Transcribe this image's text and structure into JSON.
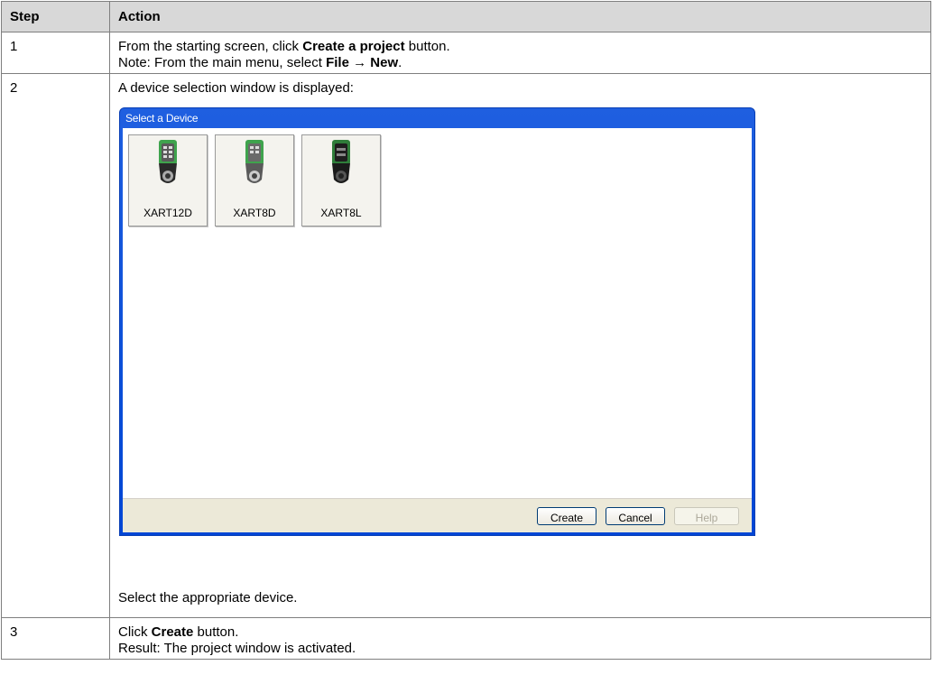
{
  "table": {
    "header": {
      "step": "Step",
      "action": "Action"
    },
    "rows": [
      {
        "step": "1",
        "line1_pre": "From the starting screen, click ",
        "line1_bold": "Create a project",
        "line1_post": " button.",
        "line2_pre": "Note: From the main menu, select ",
        "line2_bold1": "File",
        "line2_arrow": " → ",
        "line2_bold2": "New",
        "line2_post": "."
      },
      {
        "step": "2",
        "intro": "A device selection window is displayed:",
        "outro": "Select the appropriate device."
      },
      {
        "step": "3",
        "line1_pre": "Click ",
        "line1_bold": "Create",
        "line1_post": " button.",
        "line2": "Result: The project window is activated."
      }
    ]
  },
  "dialog": {
    "title": "Select a Device",
    "devices": [
      {
        "name": "XART12D",
        "icon": "remote-control-icon"
      },
      {
        "name": "XART8D",
        "icon": "remote-control-icon"
      },
      {
        "name": "XART8L",
        "icon": "remote-control-icon"
      }
    ],
    "buttons": {
      "create": "Create",
      "cancel": "Cancel",
      "help": "Help"
    },
    "colors": {
      "titlebar": "#0046d5",
      "footer": "#ece9d8",
      "device_green": "#3fa34d"
    }
  }
}
